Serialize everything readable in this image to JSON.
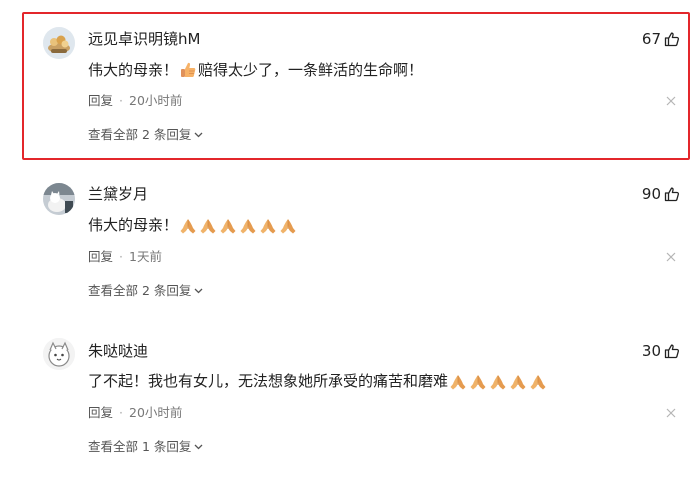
{
  "comments": [
    {
      "username": "远见卓识明镜hM",
      "likes": "67",
      "text_before": "伟大的母亲！",
      "text_after": "赔得太少了，一条鲜活的生命啊！",
      "reply_label": "回复",
      "separator": "·",
      "time": "20小时前",
      "view_all": "查看全部 2 条回复",
      "avatar_icon": "avatar-food-bowl-icon",
      "highlighted": true
    },
    {
      "username": "兰黛岁月",
      "likes": "90",
      "text_before": "伟大的母亲！",
      "emoji": "🙏",
      "emoji_count": 6,
      "reply_label": "回复",
      "separator": "·",
      "time": "1天前",
      "view_all": "查看全部 2 条回复",
      "avatar_icon": "avatar-cat-icon"
    },
    {
      "username": "朱哒哒迪",
      "likes": "30",
      "text_before": "了不起！我也有女儿，无法想象她所承受的痛苦和磨难",
      "emoji": "🙏",
      "emoji_count": 5,
      "reply_label": "回复",
      "separator": "·",
      "time": "20小时前",
      "view_all": "查看全部 1 条回复",
      "avatar_icon": "avatar-cartoon-icon"
    }
  ],
  "colors": {
    "highlight_border": "#e3262b",
    "text": "#222222",
    "meta": "#777777"
  }
}
